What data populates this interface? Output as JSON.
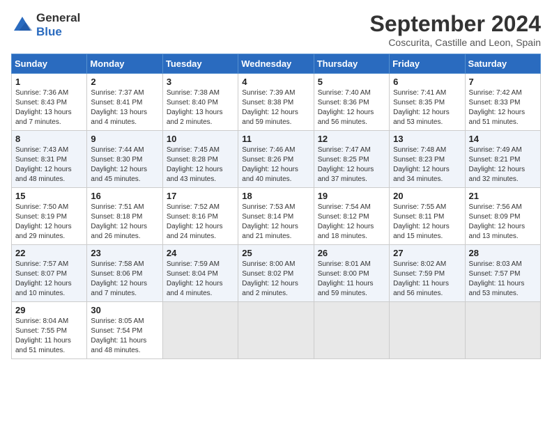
{
  "header": {
    "logo_line1": "General",
    "logo_line2": "Blue",
    "month": "September 2024",
    "location": "Coscurita, Castille and Leon, Spain"
  },
  "weekdays": [
    "Sunday",
    "Monday",
    "Tuesday",
    "Wednesday",
    "Thursday",
    "Friday",
    "Saturday"
  ],
  "weeks": [
    [
      {
        "day": 1,
        "info": "Sunrise: 7:36 AM\nSunset: 8:43 PM\nDaylight: 13 hours\nand 7 minutes."
      },
      {
        "day": 2,
        "info": "Sunrise: 7:37 AM\nSunset: 8:41 PM\nDaylight: 13 hours\nand 4 minutes."
      },
      {
        "day": 3,
        "info": "Sunrise: 7:38 AM\nSunset: 8:40 PM\nDaylight: 13 hours\nand 2 minutes."
      },
      {
        "day": 4,
        "info": "Sunrise: 7:39 AM\nSunset: 8:38 PM\nDaylight: 12 hours\nand 59 minutes."
      },
      {
        "day": 5,
        "info": "Sunrise: 7:40 AM\nSunset: 8:36 PM\nDaylight: 12 hours\nand 56 minutes."
      },
      {
        "day": 6,
        "info": "Sunrise: 7:41 AM\nSunset: 8:35 PM\nDaylight: 12 hours\nand 53 minutes."
      },
      {
        "day": 7,
        "info": "Sunrise: 7:42 AM\nSunset: 8:33 PM\nDaylight: 12 hours\nand 51 minutes."
      }
    ],
    [
      {
        "day": 8,
        "info": "Sunrise: 7:43 AM\nSunset: 8:31 PM\nDaylight: 12 hours\nand 48 minutes."
      },
      {
        "day": 9,
        "info": "Sunrise: 7:44 AM\nSunset: 8:30 PM\nDaylight: 12 hours\nand 45 minutes."
      },
      {
        "day": 10,
        "info": "Sunrise: 7:45 AM\nSunset: 8:28 PM\nDaylight: 12 hours\nand 43 minutes."
      },
      {
        "day": 11,
        "info": "Sunrise: 7:46 AM\nSunset: 8:26 PM\nDaylight: 12 hours\nand 40 minutes."
      },
      {
        "day": 12,
        "info": "Sunrise: 7:47 AM\nSunset: 8:25 PM\nDaylight: 12 hours\nand 37 minutes."
      },
      {
        "day": 13,
        "info": "Sunrise: 7:48 AM\nSunset: 8:23 PM\nDaylight: 12 hours\nand 34 minutes."
      },
      {
        "day": 14,
        "info": "Sunrise: 7:49 AM\nSunset: 8:21 PM\nDaylight: 12 hours\nand 32 minutes."
      }
    ],
    [
      {
        "day": 15,
        "info": "Sunrise: 7:50 AM\nSunset: 8:19 PM\nDaylight: 12 hours\nand 29 minutes."
      },
      {
        "day": 16,
        "info": "Sunrise: 7:51 AM\nSunset: 8:18 PM\nDaylight: 12 hours\nand 26 minutes."
      },
      {
        "day": 17,
        "info": "Sunrise: 7:52 AM\nSunset: 8:16 PM\nDaylight: 12 hours\nand 24 minutes."
      },
      {
        "day": 18,
        "info": "Sunrise: 7:53 AM\nSunset: 8:14 PM\nDaylight: 12 hours\nand 21 minutes."
      },
      {
        "day": 19,
        "info": "Sunrise: 7:54 AM\nSunset: 8:12 PM\nDaylight: 12 hours\nand 18 minutes."
      },
      {
        "day": 20,
        "info": "Sunrise: 7:55 AM\nSunset: 8:11 PM\nDaylight: 12 hours\nand 15 minutes."
      },
      {
        "day": 21,
        "info": "Sunrise: 7:56 AM\nSunset: 8:09 PM\nDaylight: 12 hours\nand 13 minutes."
      }
    ],
    [
      {
        "day": 22,
        "info": "Sunrise: 7:57 AM\nSunset: 8:07 PM\nDaylight: 12 hours\nand 10 minutes."
      },
      {
        "day": 23,
        "info": "Sunrise: 7:58 AM\nSunset: 8:06 PM\nDaylight: 12 hours\nand 7 minutes."
      },
      {
        "day": 24,
        "info": "Sunrise: 7:59 AM\nSunset: 8:04 PM\nDaylight: 12 hours\nand 4 minutes."
      },
      {
        "day": 25,
        "info": "Sunrise: 8:00 AM\nSunset: 8:02 PM\nDaylight: 12 hours\nand 2 minutes."
      },
      {
        "day": 26,
        "info": "Sunrise: 8:01 AM\nSunset: 8:00 PM\nDaylight: 11 hours\nand 59 minutes."
      },
      {
        "day": 27,
        "info": "Sunrise: 8:02 AM\nSunset: 7:59 PM\nDaylight: 11 hours\nand 56 minutes."
      },
      {
        "day": 28,
        "info": "Sunrise: 8:03 AM\nSunset: 7:57 PM\nDaylight: 11 hours\nand 53 minutes."
      }
    ],
    [
      {
        "day": 29,
        "info": "Sunrise: 8:04 AM\nSunset: 7:55 PM\nDaylight: 11 hours\nand 51 minutes."
      },
      {
        "day": 30,
        "info": "Sunrise: 8:05 AM\nSunset: 7:54 PM\nDaylight: 11 hours\nand 48 minutes."
      },
      null,
      null,
      null,
      null,
      null
    ]
  ]
}
